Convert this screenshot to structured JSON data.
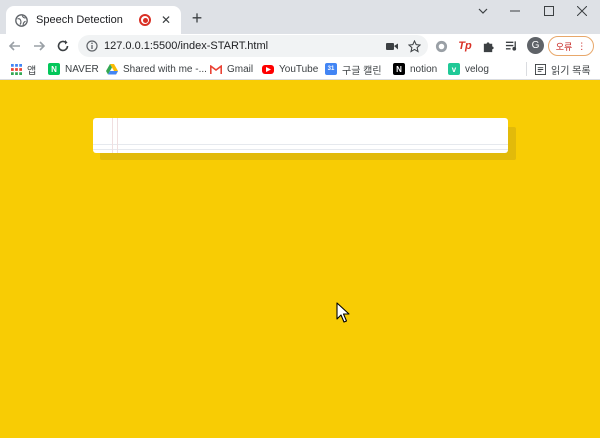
{
  "browser": {
    "tab": {
      "title": "Speech Detection"
    },
    "toolbar": {
      "url": "127.0.0.1:5500/index-START.html"
    },
    "profile": {
      "initial": "G",
      "error_label": "오류"
    },
    "bookmarks": [
      {
        "label": "앱",
        "icon": "apps-grid-icon"
      },
      {
        "label": "NAVER",
        "icon": "naver-icon",
        "color": "#03c75a",
        "glyph": "N"
      },
      {
        "label": "Shared with me -...",
        "icon": "google-drive-icon"
      },
      {
        "label": "Gmail",
        "icon": "gmail-icon"
      },
      {
        "label": "YouTube",
        "icon": "youtube-icon",
        "color": "#ff0000"
      },
      {
        "label": "구글 캘린",
        "icon": "google-calendar-icon",
        "color": "#4285f4",
        "glyph": "31"
      },
      {
        "label": "notion",
        "icon": "notion-icon",
        "color": "#000000",
        "glyph": "N"
      },
      {
        "label": "velog",
        "icon": "velog-icon",
        "color": "#20c997",
        "glyph": "v"
      }
    ],
    "reading_list": {
      "label": "읽기 목록"
    }
  },
  "page": {
    "background": "#f8cc04",
    "transcript_text": ""
  }
}
